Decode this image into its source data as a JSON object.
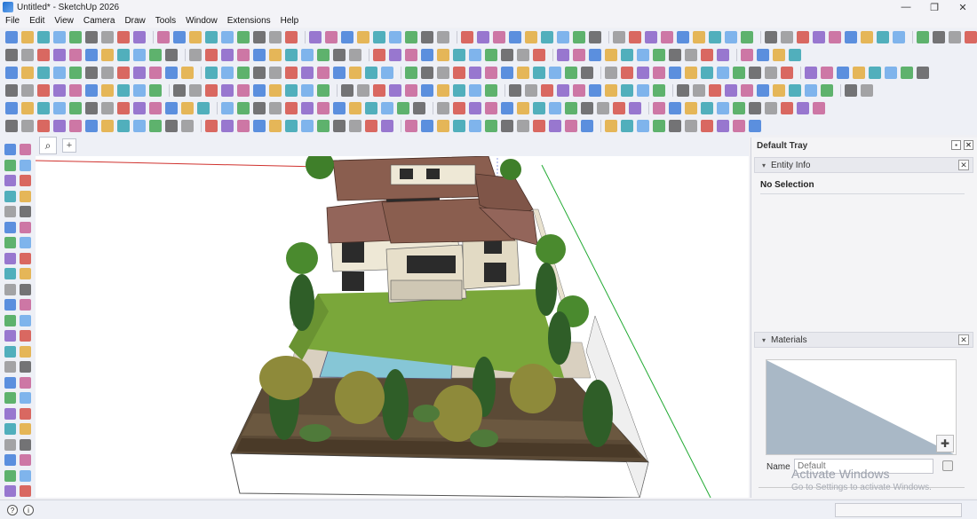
{
  "window": {
    "title": "Untitled* - SketchUp 2026",
    "controls": [
      "—",
      "❐",
      "✕"
    ]
  },
  "menu": [
    "File",
    "Edit",
    "View",
    "Camera",
    "Draw",
    "Tools",
    "Window",
    "Extensions",
    "Help"
  ],
  "scenes": {
    "search_icon": "search-icon",
    "add_label": "+"
  },
  "tray": {
    "title": "Default Tray",
    "entity_info": {
      "header": "Entity Info",
      "content": "No Selection"
    },
    "materials": {
      "header": "Materials",
      "name_label": "Name",
      "name_placeholder": "Default",
      "preview_color": "#a9b8c6"
    }
  },
  "watermark": {
    "line1": "Activate Windows",
    "line2": "Go to Settings to activate Windows."
  },
  "colors": {
    "ground": "#6f8a3c",
    "lawn": "#7aa73a",
    "roof": "#8a5e4f",
    "wall": "#eee8d6",
    "pool": "#86c6d6",
    "axis_red": "#d0322e",
    "axis_green": "#22aa33"
  },
  "status": {
    "icons": [
      "help-icon",
      "info-icon"
    ]
  }
}
